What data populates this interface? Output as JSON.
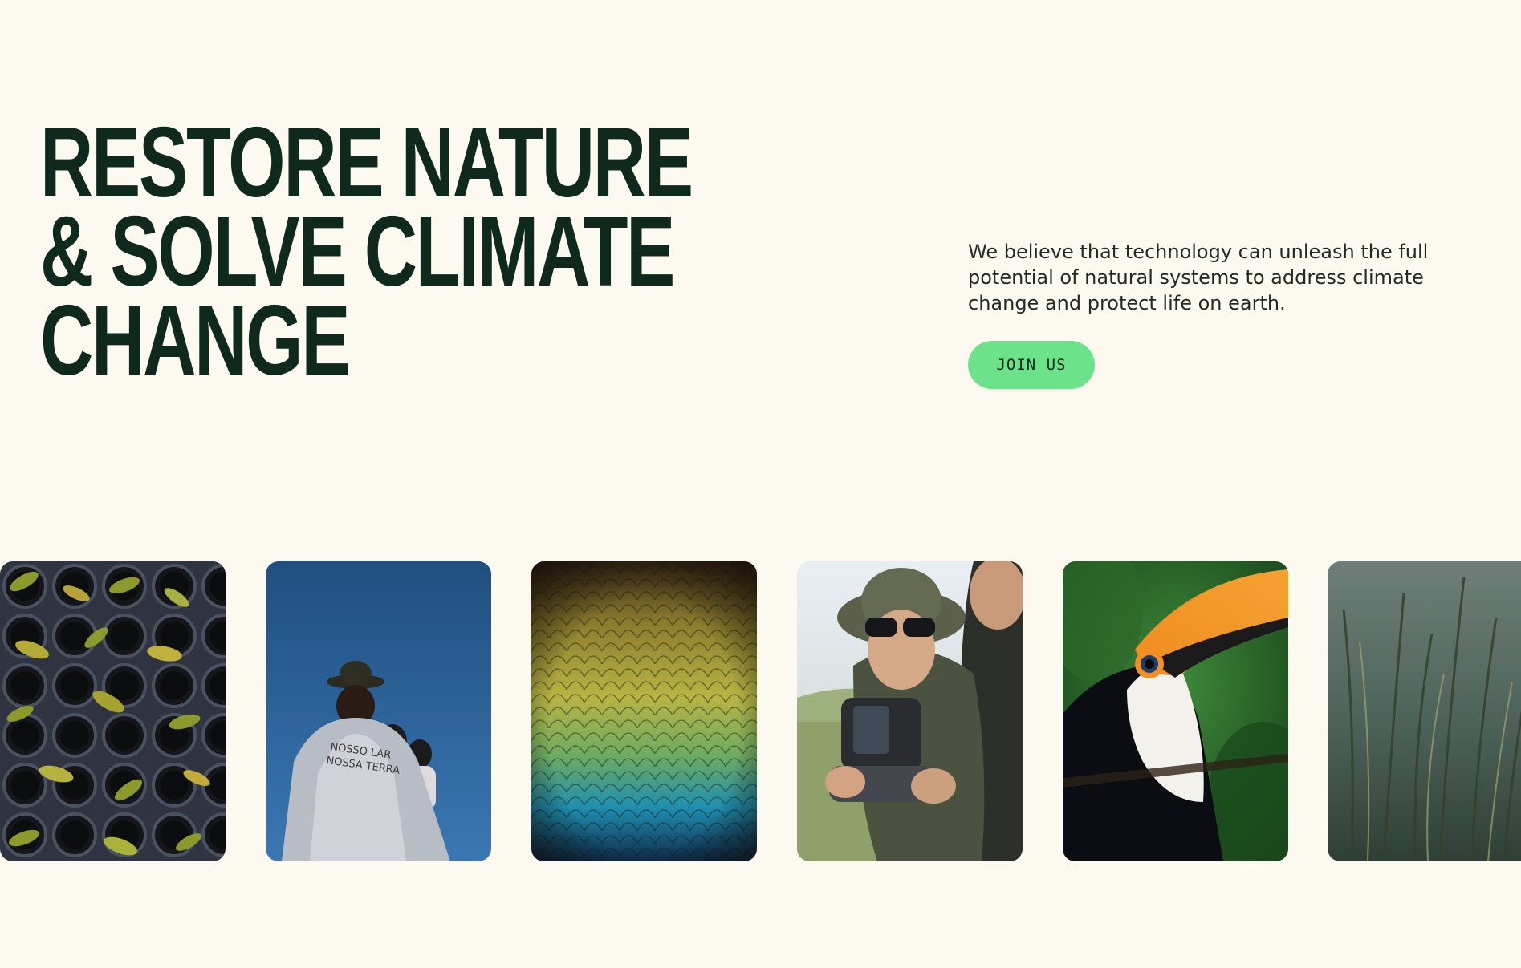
{
  "hero": {
    "title_lines": [
      "RESTORE NATURE",
      "& SOLVE CLIMATE",
      "CHANGE"
    ],
    "description": "We believe that technology can unleash the full potential of natural systems to address climate change and protect life on earth.",
    "cta_label": "JOIN US"
  },
  "colors": {
    "background": "#fcf9f1",
    "heading": "#0f2a1d",
    "cta_background": "#6ce38a"
  },
  "gallery": {
    "photos": [
      {
        "subject": "seedling-tray-photo"
      },
      {
        "subject": "volunteers-walking-photo"
      },
      {
        "subject": "peacock-feathers-photo"
      },
      {
        "subject": "field-team-drone-photo"
      },
      {
        "subject": "toucan-photo"
      },
      {
        "subject": "wetland-grass-photo"
      }
    ]
  }
}
